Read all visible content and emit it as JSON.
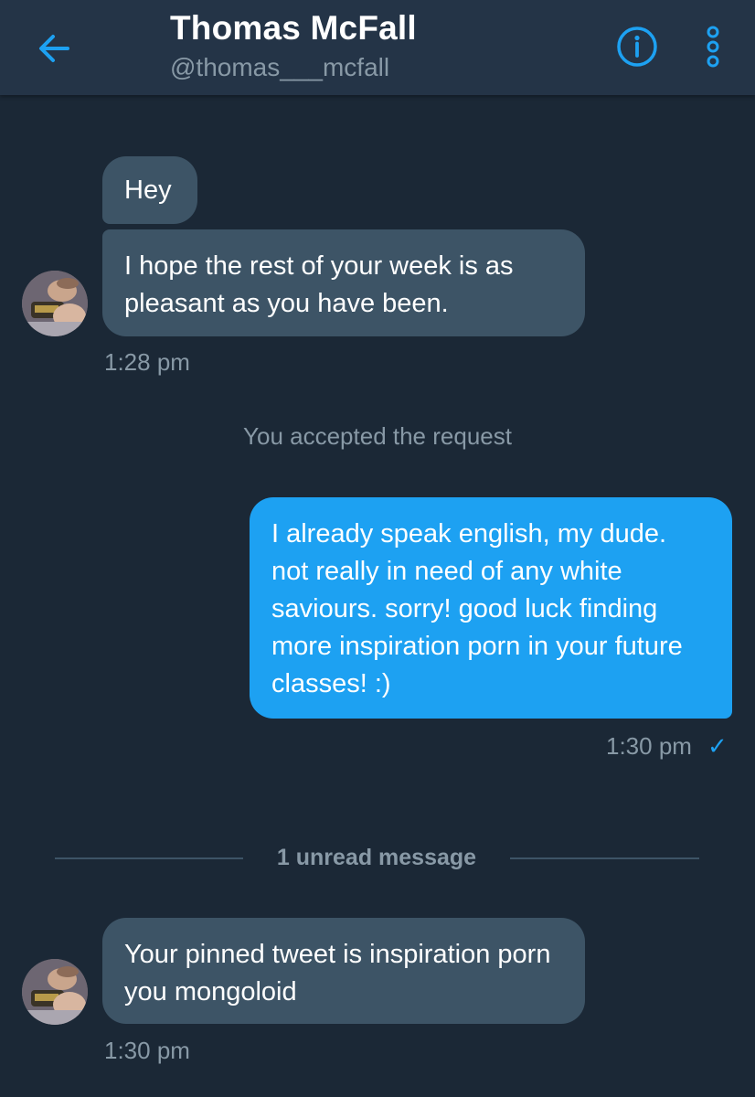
{
  "header": {
    "title": "Thomas McFall",
    "handle": "@thomas___mcfall",
    "back_icon": "arrow-left-icon",
    "info_icon": "info-icon",
    "more_icon": "more-vertical-icon"
  },
  "messages": [
    {
      "direction": "incoming",
      "text": "Hey"
    },
    {
      "direction": "incoming",
      "text": "I hope the rest of your week is as pleasant as you have been.",
      "time": "1:28 pm"
    },
    {
      "direction": "outgoing",
      "text": "I already speak english, my dude. not really in need of any white saviours. sorry! good luck finding more inspiration porn in your future classes! :)",
      "time": "1:30 pm",
      "status": "✓"
    },
    {
      "direction": "incoming",
      "text": "Your pinned tweet is inspiration porn you mongoloid",
      "time": "1:30 pm"
    }
  ],
  "system_message": "You accepted the request",
  "unread_divider": "1 unread message",
  "colors": {
    "background": "#1b2836",
    "header": "#243447",
    "incoming_bubble": "#3d5466",
    "outgoing_bubble": "#1da1f2",
    "accent": "#1da1f2",
    "muted_text": "#8899a6"
  }
}
